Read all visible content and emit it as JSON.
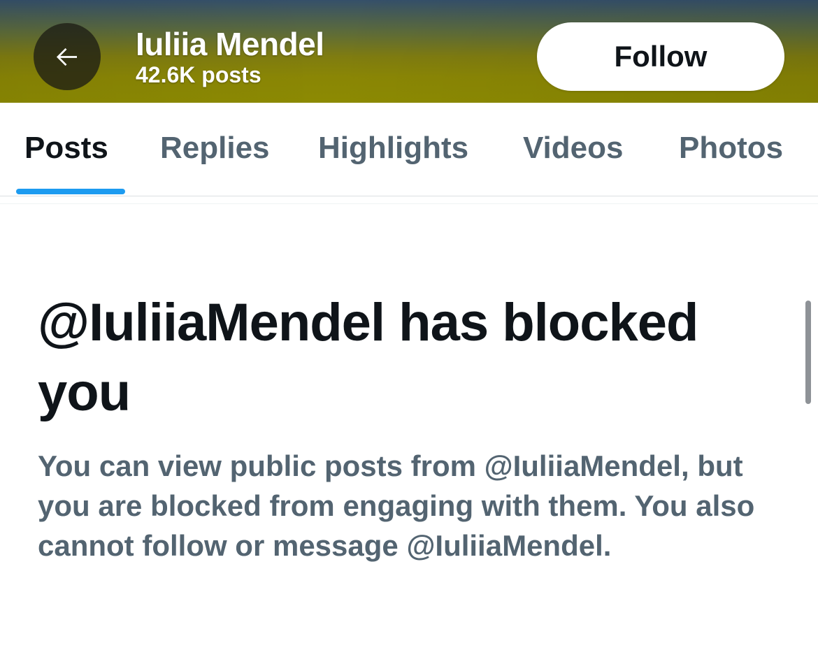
{
  "header": {
    "back_icon": "arrow-left-icon",
    "profile_name": "Iuliia Mendel",
    "post_count": "42.6K posts",
    "follow_label": "Follow",
    "banner_colors": [
      "#35506a",
      "#8c8a02"
    ]
  },
  "tabs": [
    {
      "label": "Posts",
      "active": true
    },
    {
      "label": "Replies",
      "active": false
    },
    {
      "label": "Highlights",
      "active": false
    },
    {
      "label": "Videos",
      "active": false
    },
    {
      "label": "Photos",
      "active": false
    }
  ],
  "blocked": {
    "heading": "@IuliiaMendel has blocked you",
    "message": "You can view public posts from @IuliiaMendel, but you are blocked from engaging with them. You also cannot follow or message @IuliiaMendel."
  },
  "colors": {
    "accent": "#1d9bf0",
    "primary_text": "#0f1419",
    "secondary_text": "#536471"
  }
}
